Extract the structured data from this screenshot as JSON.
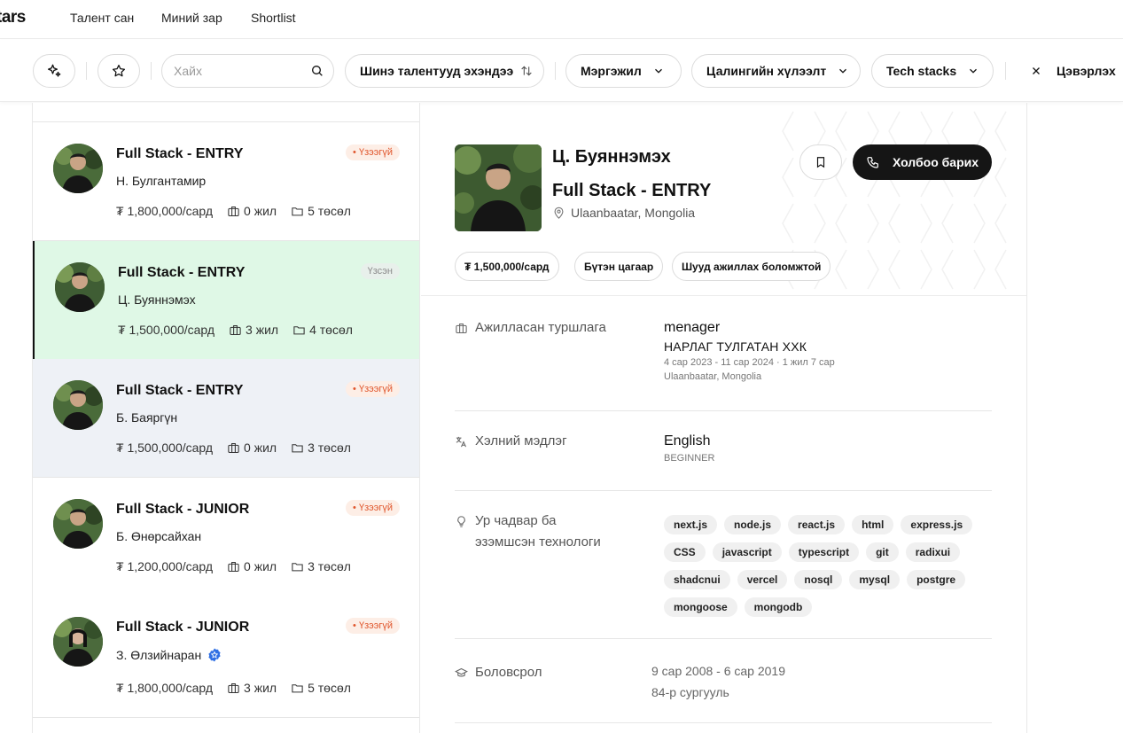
{
  "nav": {
    "logo": "tars",
    "links": [
      "Талент сан",
      "Миний зар",
      "Shortlist"
    ]
  },
  "filters": {
    "search_placeholder": "Хайх",
    "sort_label": "Шинэ талентууд эхэндээ",
    "specialty_label": "Мэргэжил",
    "salary_label": "Цалингийн хүлээлт",
    "tech_label": "Tech stacks",
    "clear_label": "Цэвэрлэх"
  },
  "candidates": [
    {
      "title": "Full Stack - ENTRY",
      "name": "Н. Булгантамир",
      "salary": "₮ 1,800,000/сард",
      "experience": "0 жил",
      "projects": "5 төсөл",
      "badge": "• Үзээгүй",
      "seen": false
    },
    {
      "title": "Full Stack - ENTRY",
      "name": "Ц. Буяннэмэх",
      "salary": "₮ 1,500,000/сард",
      "experience": "3 жил",
      "projects": "4 төсөл",
      "badge": "Үзсэн",
      "seen": true
    },
    {
      "title": "Full Stack - ENTRY",
      "name": "Б. Баяргүн",
      "salary": "₮ 1,500,000/сард",
      "experience": "0 жил",
      "projects": "3 төсөл",
      "badge": "• Үзээгүй",
      "seen": false
    },
    {
      "title": "Full Stack - JUNIOR",
      "name": "Б. Өнөрсайхан",
      "salary": "₮ 1,200,000/сард",
      "experience": "0 жил",
      "projects": "3 төсөл",
      "badge": "• Үзээгүй",
      "seen": false
    },
    {
      "title": "Full Stack - JUNIOR",
      "name": "З. Өлзийнаран",
      "salary": "₮ 1,800,000/сард",
      "experience": "3 жил",
      "projects": "5 төсөл",
      "badge": "• Үзээгүй",
      "seen": false,
      "verified": true
    }
  ],
  "detail": {
    "name": "Ц. Буяннэмэх",
    "role": "Full Stack - ENTRY",
    "location": "Ulaanbaatar, Mongolia",
    "contact_label": "Холбоо барих",
    "chips": [
      "₮ 1,500,000/сард",
      "Бүтэн цагаар",
      "Шууд ажиллах боломжтой"
    ],
    "experience": {
      "label": "Ажилласан туршлага",
      "position": "menager",
      "company": "НАРЛАГ ТУЛГАТАН ХХК",
      "period": "4 сар 2023 - 11 сар 2024 · 1 жил 7 сар",
      "location": "Ulaanbaatar, Mongolia"
    },
    "language": {
      "label": "Хэлний мэдлэг",
      "name": "English",
      "level": "BEGINNER"
    },
    "skills": {
      "label_line1": "Ур чадвар ба",
      "label_line2": "эзэмшсэн технологи",
      "tags": [
        "next.js",
        "node.js",
        "react.js",
        "html",
        "express.js",
        "CSS",
        "javascript",
        "typescript",
        "git",
        "radixui",
        "shadcnui",
        "vercel",
        "nosql",
        "mysql",
        "postgre",
        "mongoose",
        "mongodb"
      ]
    },
    "education": {
      "label": "Боловсрол",
      "period": "9 сар 2008 - 6 сар 2019",
      "school": "84-р сургууль"
    }
  },
  "colors": {
    "active_card_bg": "#dff8e6",
    "unseen_badge": "#e0552b",
    "primary_button": "#151515",
    "verified_badge": "#2f6fe4"
  }
}
